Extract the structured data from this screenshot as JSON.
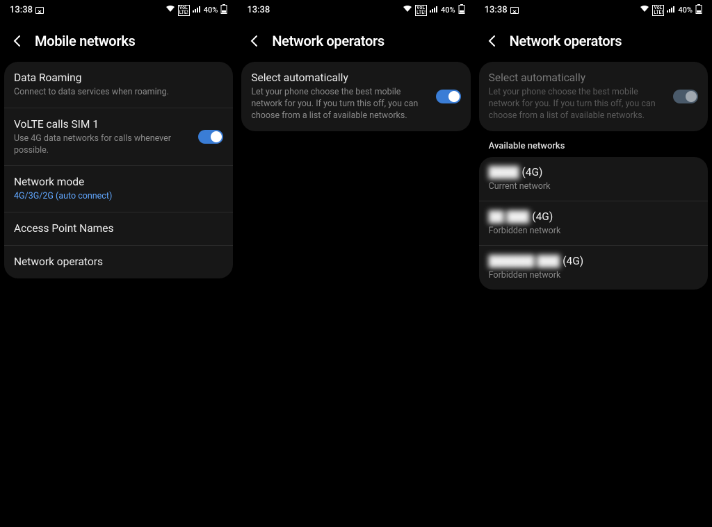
{
  "status": {
    "time": "13:38",
    "battery": "40%",
    "volte": "VoLTE"
  },
  "screens": [
    {
      "title": "Mobile networks",
      "has_pic_icon": true,
      "rows": [
        {
          "id": "data-roaming",
          "title": "Data Roaming",
          "sub": "Connect to data services when roaming.",
          "toggle": null,
          "accent": false
        },
        {
          "id": "volte-calls",
          "title": "VoLTE calls SIM 1",
          "sub": "Use 4G data networks for calls whenever possible.",
          "toggle": "on",
          "accent": false
        },
        {
          "id": "network-mode",
          "title": "Network mode",
          "sub": "4G/3G/2G (auto connect)",
          "toggle": null,
          "accent": true
        },
        {
          "id": "apn",
          "title": "Access Point Names",
          "sub": null,
          "toggle": null
        },
        {
          "id": "operators",
          "title": "Network operators",
          "sub": null,
          "toggle": null
        }
      ]
    },
    {
      "title": "Network operators",
      "has_pic_icon": false,
      "select_auto": {
        "title": "Select automatically",
        "sub": "Let your phone choose the best mobile network for you. If you turn this off, you can choose from a list of available networks.",
        "toggle": "on",
        "dim": false
      }
    },
    {
      "title": "Network operators",
      "has_pic_icon": true,
      "select_auto": {
        "title": "Select automatically",
        "sub": "Let your phone choose the best mobile network for you. If you turn this off, you can choose from a list of available networks.",
        "toggle": "off",
        "dim": true
      },
      "available_label": "Available networks",
      "networks": [
        {
          "hidden": "████",
          "suffix": " (4G)",
          "status": "Current network"
        },
        {
          "hidden": "██ ███",
          "suffix": " (4G)",
          "status": "Forbidden network"
        },
        {
          "hidden": "██████ ███",
          "suffix": " (4G)",
          "status": "Forbidden network"
        }
      ]
    }
  ]
}
